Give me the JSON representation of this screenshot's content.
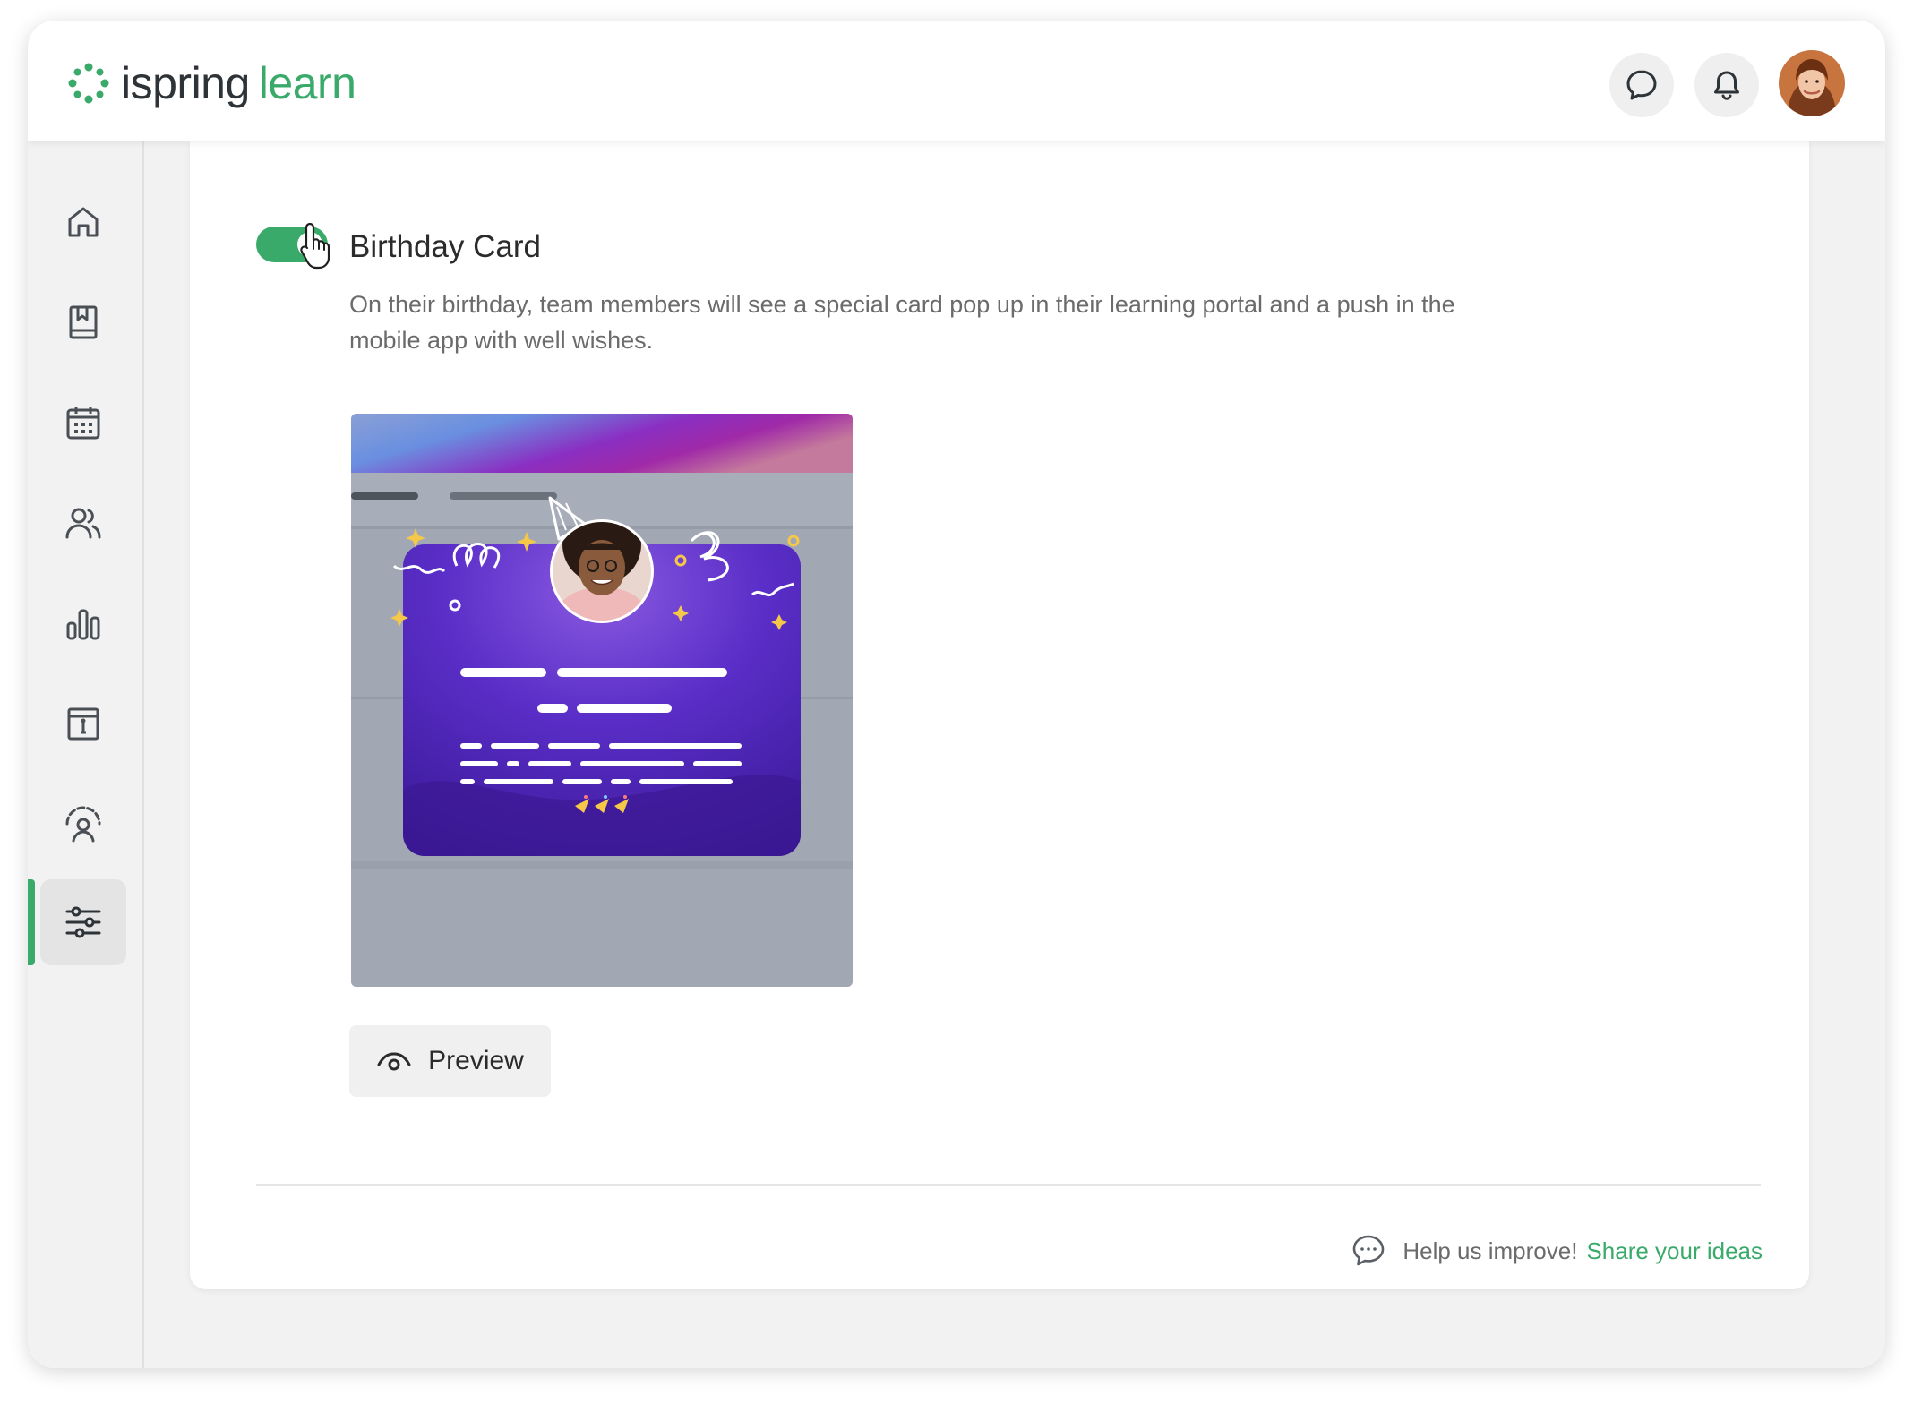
{
  "header": {
    "brand_name": "ispring",
    "brand_product": "learn",
    "chat_icon": "chat-bubble-icon",
    "notifications_icon": "bell-icon"
  },
  "sidebar": {
    "items": [
      {
        "icon": "home-icon"
      },
      {
        "icon": "book-icon"
      },
      {
        "icon": "calendar-icon"
      },
      {
        "icon": "users-icon"
      },
      {
        "icon": "bar-chart-icon"
      },
      {
        "icon": "info-board-icon"
      },
      {
        "icon": "user-gauge-icon"
      },
      {
        "icon": "sliders-icon",
        "active": true
      }
    ]
  },
  "settings": {
    "toggle_enabled": true,
    "title": "Birthday Card",
    "description": "On their birthday, team members will see a special card pop up in their learning portal and a push in the mobile app with well wishes.",
    "preview_label": "Preview"
  },
  "footer": {
    "help_text": "Help us improve!",
    "link_text": "Share your ideas"
  },
  "colors": {
    "accent": "#3aaa6b",
    "card_purple": "#6a35d4",
    "page_bg": "#f2f2f2"
  }
}
